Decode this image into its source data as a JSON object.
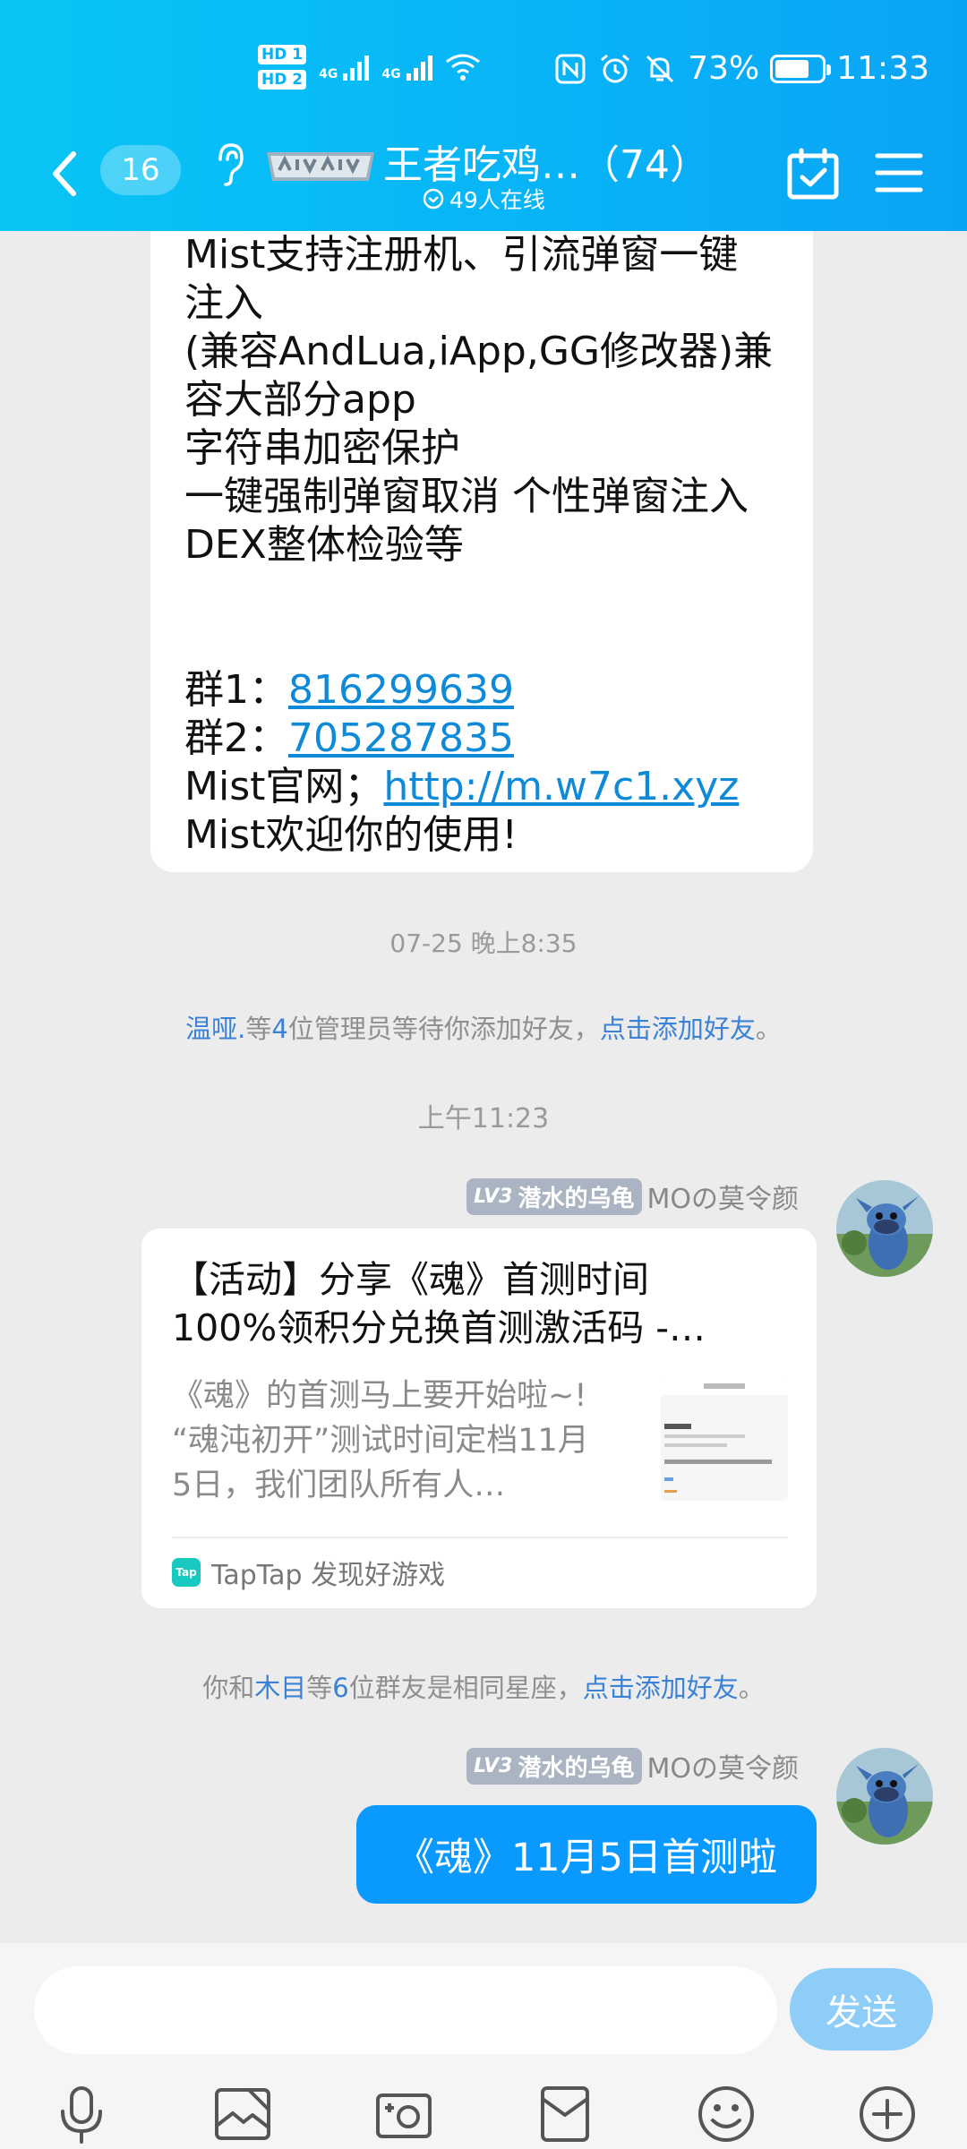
{
  "status_bar": {
    "hd1": "HD 1",
    "hd2": "HD 2",
    "net1": "4G",
    "net2": "4G",
    "battery_percent": "73%",
    "battery_level": 0.73,
    "time": "11:33",
    "icons": [
      "nfc-icon",
      "alarm-icon",
      "mute-icon"
    ]
  },
  "nav": {
    "unread_count": "16",
    "group_title": "王者吃鸡…（74）",
    "online_text": "49人在线"
  },
  "messages": {
    "first_bubble_lines": [
      "Mist支持注册机、引流弹窗一键",
      "注入",
      "(兼容AndLua,iApp,GG修改器)兼",
      "容大部分app",
      "字符串加密保护",
      "一键强制弹窗取消 个性弹窗注入",
      "DEX整体检验等"
    ],
    "group1_label": "群1：",
    "group1_number": "816299639",
    "group2_label": "群2：",
    "group2_number": "705287835",
    "site_label": "Mist官网；",
    "site_url": "http://m.w7c1.xyz",
    "welcome": "Mist欢迎你的使用!",
    "timestamp1": "07-25 晚上8:35",
    "admin_notice": {
      "name": "温哑.",
      "pre": "等",
      "count": "4",
      "post": "位管理员等待你添加好友，",
      "link": "点击添加好友",
      "end": "。"
    },
    "timestamp2": "上午11:23",
    "sender": {
      "level": "LV3",
      "title": "潜水的乌龟",
      "name": "MOの莫令颜"
    },
    "card": {
      "title_line1": "【活动】分享《魂》首测时间",
      "title_line2": "100%领积分兑换首测激活码 -…",
      "desc_line1": "《魂》的首测马上要开始啦~!",
      "desc_line2": "“魂沌初开”测试时间定档11月",
      "desc_line3": "5日，我们团队所有人…",
      "source": "TapTap 发现好游戏",
      "source_icon_text": "Tap"
    },
    "zodiac_notice": {
      "pre": "你和",
      "name": "木目",
      "mid": "等",
      "count": "6",
      "post": "位群友是相同星座，",
      "link": "点击添加好友",
      "end": "。"
    },
    "my_message": "《魂》11月5日首测啦"
  },
  "input": {
    "placeholder": "",
    "send_label": "发送"
  },
  "toolbar": [
    "microphone-icon",
    "image-icon",
    "camera-icon",
    "red-packet-icon",
    "emoji-icon",
    "plus-icon"
  ],
  "colors": {
    "header": "#08b6f6",
    "link": "#0e8ad8",
    "highlight": "#3b82d6",
    "my_bubble": "#0a99ff",
    "send_button": "#8ecdf7"
  }
}
